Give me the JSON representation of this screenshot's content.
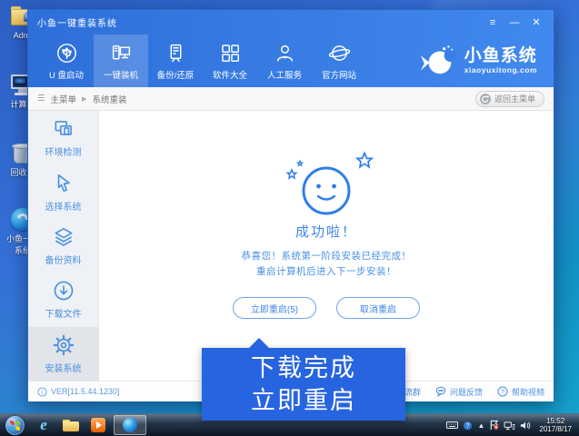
{
  "window": {
    "title": "小鱼一键重装系统",
    "controls": {
      "menu": "≡",
      "minimize": "—",
      "close": "✕"
    }
  },
  "nav": {
    "items": [
      {
        "label": "U 盘启动",
        "icon": "usb-icon",
        "active": false
      },
      {
        "label": "一键装机",
        "icon": "computer-icon",
        "active": true
      },
      {
        "label": "备份/还原",
        "icon": "server-icon",
        "active": false
      },
      {
        "label": "软件大全",
        "icon": "apps-grid-icon",
        "active": false
      },
      {
        "label": "人工服务",
        "icon": "person-icon",
        "active": false
      },
      {
        "label": "官方网站",
        "icon": "globe-icon",
        "active": false
      }
    ]
  },
  "brand": {
    "name": "小鱼系统",
    "domain": "xiaoyuxitong.com"
  },
  "breadcrumb": {
    "menu_glyph": "☰",
    "root": "主菜单",
    "separator": "▶",
    "current": "系统重装",
    "back_label": "返回主菜单"
  },
  "sidebar": {
    "items": [
      {
        "label": "环境检测",
        "icon": "windows-overlap-icon",
        "active": false
      },
      {
        "label": "选择系统",
        "icon": "cursor-icon",
        "active": false
      },
      {
        "label": "备份资料",
        "icon": "layers-icon",
        "active": false
      },
      {
        "label": "下载文件",
        "icon": "download-icon",
        "active": false
      },
      {
        "label": "安装系统",
        "icon": "gear-icon",
        "active": true
      }
    ]
  },
  "main": {
    "title": "成功啦！",
    "line1": "恭喜您！系统第一阶段安装已经完成！",
    "line2": "重启计算机后进入下一步安装！",
    "restart": "立即重启(5)",
    "cancel": "取消重启"
  },
  "callout": {
    "line1": "下载完成",
    "line2": "立即重启"
  },
  "statusbar": {
    "version": "VER[11.5.44.1230]",
    "links": [
      {
        "label": "交流群",
        "icon": "people-icon"
      },
      {
        "label": "问题反馈",
        "icon": "chat-bubble-icon"
      },
      {
        "label": "帮助视频",
        "icon": "help-circle-icon"
      }
    ]
  },
  "desktop": {
    "icons": [
      {
        "label": "Admi"
      },
      {
        "label": "计算机"
      },
      {
        "label": "回收站"
      },
      {
        "line1": "小鱼一键",
        "line2": "系统"
      }
    ]
  },
  "taskbar": {
    "time": "15:52",
    "date": "2017/8/17"
  },
  "colors": {
    "header_blue": "#2e6fd9",
    "header_blue_light": "#4189ee",
    "accent_blue": "#4a90e2",
    "callout_blue": "#2764e0",
    "success_blue": "#2e7ee8"
  }
}
